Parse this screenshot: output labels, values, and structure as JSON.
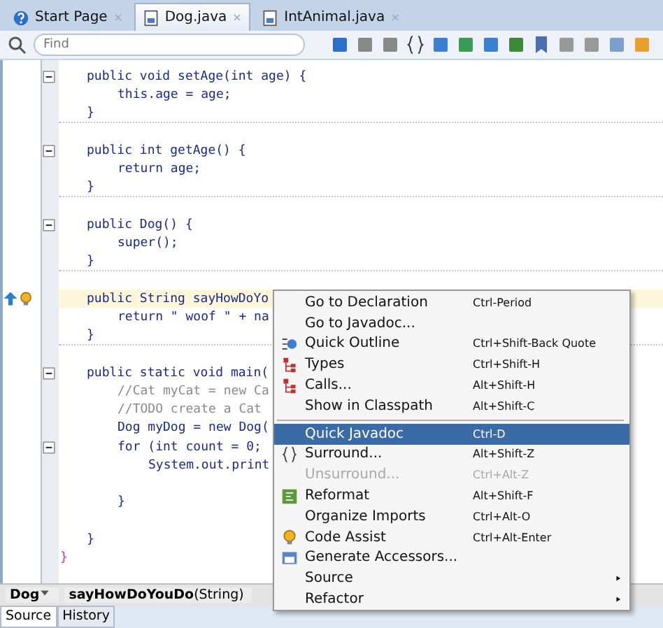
{
  "tabs": [
    {
      "label": "Start Page",
      "selected": false
    },
    {
      "label": "Dog.java",
      "selected": true
    },
    {
      "label": "IntAnimal.java",
      "selected": false
    }
  ],
  "toolbar": {
    "search": {
      "placeholder": "Find"
    }
  },
  "editor": {
    "children": [
      {
        "kind": "code",
        "fold": true,
        "highlighted": false,
        "markers": false,
        "text": "public void setAge(int age) {",
        "children": [
          {
            "kind": "code",
            "text": "this.age = age;"
          }
        ]
      },
      {
        "kind": "code",
        "text": "}"
      },
      {
        "kind": "blank"
      },
      {
        "kind": "code",
        "fold": true,
        "highlighted": false,
        "markers": false,
        "text": "public int getAge() {",
        "children": [
          {
            "kind": "code",
            "text": "return age;"
          }
        ]
      },
      {
        "kind": "code",
        "text": "}"
      },
      {
        "kind": "blank"
      },
      {
        "kind": "code",
        "fold": true,
        "highlighted": false,
        "markers": false,
        "text": "public Dog() {",
        "children": [
          {
            "kind": "code",
            "text": "super();"
          }
        ]
      },
      {
        "kind": "code",
        "text": "}"
      },
      {
        "kind": "blank"
      },
      {
        "kind": "code",
        "fold": false,
        "highlighted": true,
        "markers": true,
        "text": "public String sayHowDoYo",
        "children": [
          {
            "kind": "code",
            "text": "return \" woof \" + na"
          }
        ]
      },
      {
        "kind": "code",
        "text": "}"
      },
      {
        "kind": "blank"
      },
      {
        "kind": "code",
        "fold": true,
        "highlighted": false,
        "markers": false,
        "text": "public static void main(",
        "children": [
          {
            "kind": "comment",
            "text": "//Cat myCat = new Ca"
          },
          {
            "kind": "comment",
            "text": "//TODO create a Cat"
          },
          {
            "kind": "code",
            "text": "Dog myDog = new Dog("
          },
          {
            "kind": "code",
            "fold": true,
            "highlighted": false,
            "markers": false,
            "text": "for (int count = 0;",
            "children": [
              {
                "kind": "code",
                "text": "System.out.print"
              },
              {
                "kind": "empty"
              }
            ]
          },
          {
            "kind": "code",
            "text": "}"
          },
          {
            "kind": "empty"
          }
        ]
      },
      {
        "kind": "code",
        "text": "}"
      }
    ],
    "closing": "}"
  },
  "context_menu": {
    "items": [
      {
        "kind": "item",
        "label": "Go to Declaration",
        "shortcut": "Ctrl-Period",
        "selected": false,
        "disabled": false,
        "submenu": false
      },
      {
        "kind": "item",
        "label": "Go to Javadoc...",
        "selected": false,
        "disabled": false,
        "submenu": false
      },
      {
        "kind": "item",
        "label": "Quick Outline",
        "shortcut": "Ctrl+Shift-Back Quote",
        "selected": false,
        "disabled": false,
        "submenu": false
      },
      {
        "kind": "item",
        "label": "Types",
        "shortcut": "Ctrl+Shift-H",
        "selected": false,
        "disabled": false,
        "submenu": false
      },
      {
        "kind": "item",
        "label": "Calls...",
        "shortcut": "Alt+Shift-H",
        "selected": false,
        "disabled": false,
        "submenu": false
      },
      {
        "kind": "item",
        "label": "Show in Classpath",
        "shortcut": "Alt+Shift-C",
        "selected": false,
        "disabled": false,
        "submenu": false
      },
      {
        "kind": "separator"
      },
      {
        "kind": "item",
        "label": "Quick Javadoc",
        "shortcut": "Ctrl-D",
        "selected": true,
        "disabled": false,
        "submenu": false
      },
      {
        "kind": "item",
        "label": "Surround...",
        "shortcut": "Alt+Shift-Z",
        "selected": false,
        "disabled": false,
        "submenu": false
      },
      {
        "kind": "item",
        "label": "Unsurround...",
        "shortcut": "Ctrl+Alt-Z",
        "selected": false,
        "disabled": true,
        "submenu": false
      },
      {
        "kind": "item",
        "label": "Reformat",
        "shortcut": "Alt+Shift-F",
        "selected": false,
        "disabled": false,
        "submenu": false
      },
      {
        "kind": "item",
        "label": "Organize Imports",
        "shortcut": "Ctrl+Alt-O",
        "selected": false,
        "disabled": false,
        "submenu": false
      },
      {
        "kind": "item",
        "label": "Code Assist",
        "shortcut": "Ctrl+Alt-Enter",
        "selected": false,
        "disabled": false,
        "submenu": false
      },
      {
        "kind": "item",
        "label": "Generate Accessors...",
        "selected": false,
        "disabled": false,
        "submenu": false
      },
      {
        "kind": "item",
        "label": "Source",
        "submenu": true,
        "selected": false,
        "disabled": false
      },
      {
        "kind": "item",
        "label": "Refactor",
        "submenu": true,
        "selected": false,
        "disabled": false
      }
    ]
  },
  "breadcrumb": [
    {
      "label": "Dog",
      "dropdown": true
    },
    {
      "label": "**sayHowDoYouDo**(String)",
      "dropdown": false
    }
  ],
  "bottom_tabs": [
    {
      "label": "Source",
      "selected": true
    },
    {
      "label": "History",
      "selected": false
    }
  ]
}
